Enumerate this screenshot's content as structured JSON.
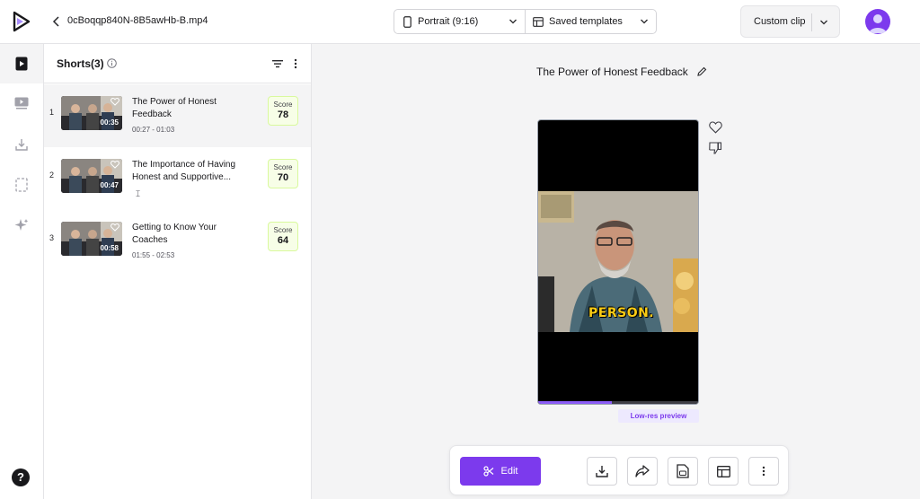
{
  "header": {
    "filename": "0cBoqqp840N-8B5awHb-B.mp4",
    "aspect_label": "Portrait (9:16)",
    "templates_label": "Saved templates",
    "custom_clip_label": "Custom clip"
  },
  "rail": {
    "items": [
      "shorts-icon",
      "videos-icon",
      "download-icon",
      "crop-icon",
      "sparkle-icon"
    ],
    "help_label": "?"
  },
  "panel": {
    "title": "Shorts(3)",
    "items": [
      {
        "index": "1",
        "title": "The Power of Honest Feedback",
        "duration": "00:35",
        "time": "00:27 - 01:03",
        "score_label": "Score",
        "score": "78"
      },
      {
        "index": "2",
        "title": "The Importance of Having Honest and Supportive...",
        "duration": "00:47",
        "time": "",
        "score_label": "Score",
        "score": "70"
      },
      {
        "index": "3",
        "title": "Getting to Know Your Coaches",
        "duration": "00:58",
        "time": "01:55 - 02:53",
        "score_label": "Score",
        "score": "64"
      }
    ]
  },
  "main": {
    "title": "The Power of Honest Feedback",
    "caption": "PERSON.",
    "progress": 0.46,
    "lowres_label": "Low-res preview"
  },
  "toolbar": {
    "edit_label": "Edit"
  },
  "colors": {
    "accent": "#7c3aed",
    "score_bg": "#f7fee7",
    "caption": "#facc15"
  }
}
